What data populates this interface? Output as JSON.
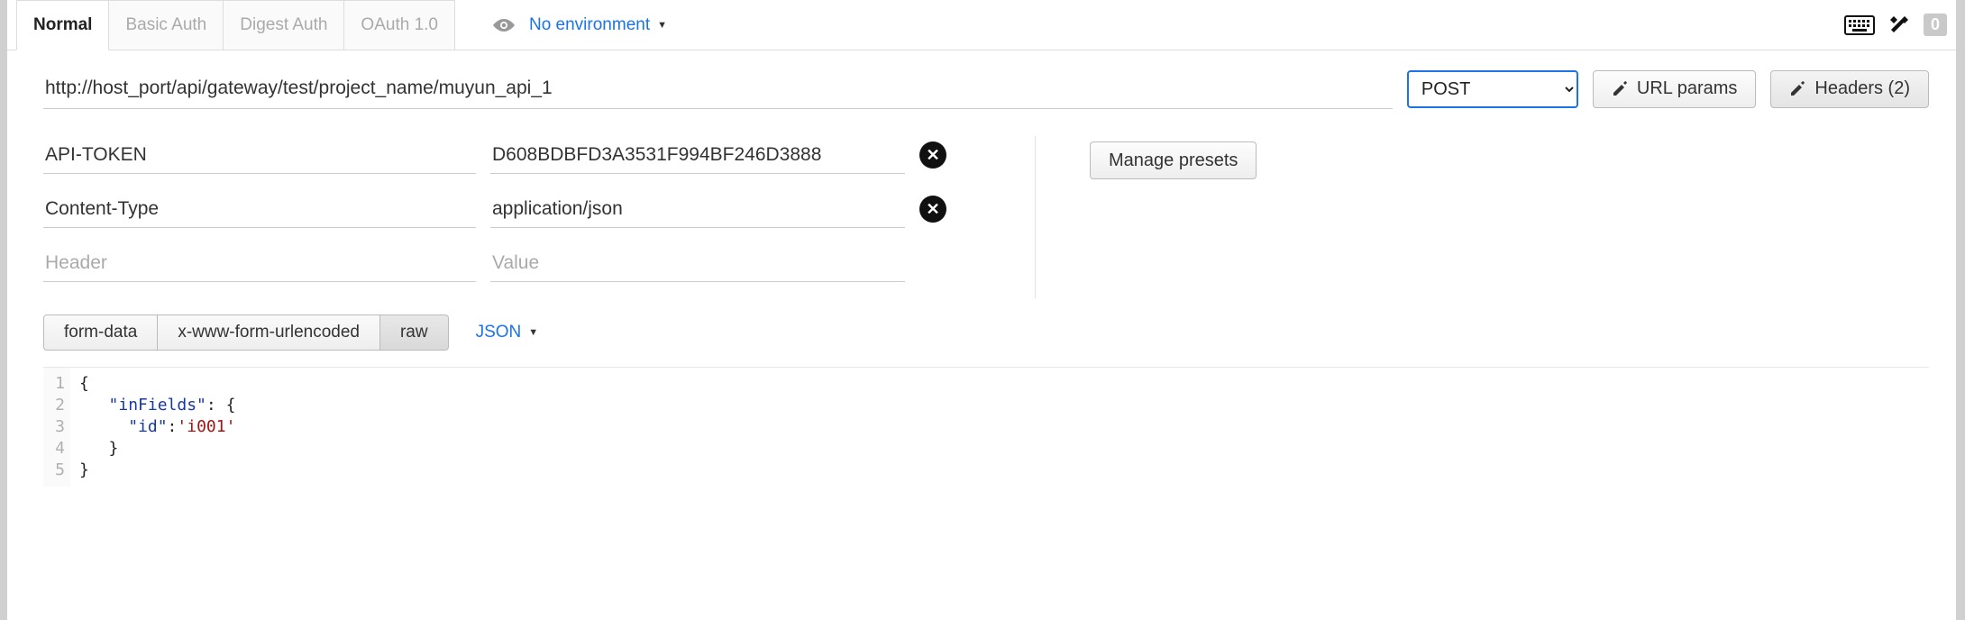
{
  "topbar": {
    "authTabs": [
      {
        "label": "Normal",
        "active": true
      },
      {
        "label": "Basic Auth",
        "active": false
      },
      {
        "label": "Digest Auth",
        "active": false
      },
      {
        "label": "OAuth 1.0",
        "active": false
      }
    ],
    "environment": {
      "label": "No environment"
    },
    "badge": "0"
  },
  "request": {
    "url": "http://host_port/api/gateway/test/project_name/muyun_api_1",
    "method": "POST",
    "urlParamsBtn": "URL params",
    "headersBtn": "Headers (2)"
  },
  "headers": {
    "rows": [
      {
        "key": "API-TOKEN",
        "value": "D608BDBFD3A3531F994BF246D3888"
      },
      {
        "key": "Content-Type",
        "value": "application/json"
      }
    ],
    "placeholderKey": "Header",
    "placeholderValue": "Value",
    "managePresets": "Manage presets"
  },
  "body": {
    "typeTabs": [
      {
        "label": "form-data",
        "selected": false
      },
      {
        "label": "x-www-form-urlencoded",
        "selected": false
      },
      {
        "label": "raw",
        "selected": true
      }
    ],
    "formatLabel": "JSON",
    "code": {
      "lineCount": 5,
      "k1": "\"inFields\"",
      "k2": "\"id\"",
      "v2": "'i001'"
    }
  }
}
